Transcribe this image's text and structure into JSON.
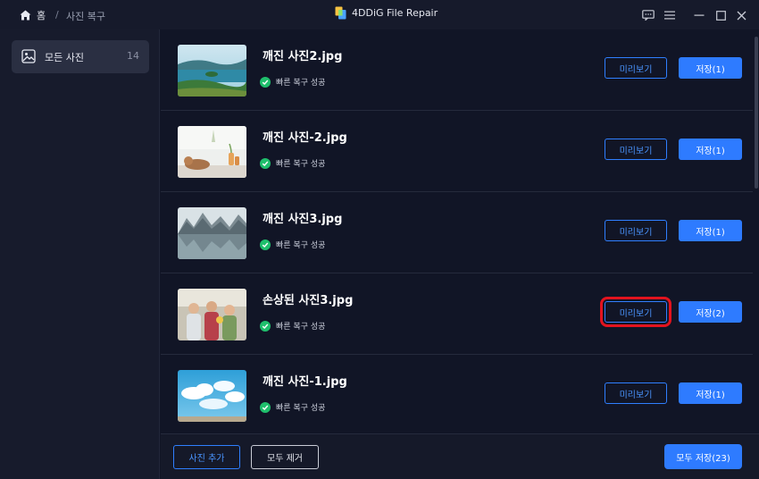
{
  "header": {
    "home_label": "홈",
    "separator": "/",
    "breadcrumb": "사진 복구",
    "app_title": "4DDiG File Repair"
  },
  "sidebar": {
    "items": [
      {
        "label": "모든 사진",
        "count": "14",
        "icon": "image-icon"
      }
    ]
  },
  "files": [
    {
      "name": "깨진 사진2.jpg",
      "status": "빠른 복구 성공",
      "preview_label": "미리보기",
      "save_label": "저장(1)",
      "thumb": "lake-island"
    },
    {
      "name": "깨진 사진-2.jpg",
      "status": "빠른 복구 성공",
      "preview_label": "미리보기",
      "save_label": "저장(1)",
      "thumb": "cat-window"
    },
    {
      "name": "깨진 사진3.jpg",
      "status": "빠른 복구 성공",
      "preview_label": "미리보기",
      "save_label": "저장(1)",
      "thumb": "mountain-lake"
    },
    {
      "name": "손상된 사진3.jpg",
      "status": "빠른 복구 성공",
      "preview_label": "미리보기",
      "save_label": "저장(2)",
      "thumb": "family"
    },
    {
      "name": "깨진 사진-1.jpg",
      "status": "빠른 복구 성공",
      "preview_label": "미리보기",
      "save_label": "저장(1)",
      "thumb": "sky-clouds"
    }
  ],
  "footer": {
    "add_label": "사진 추가",
    "remove_label": "모두 제거",
    "save_all_label": "모두 저장(23)"
  },
  "colors": {
    "accent": "#2e7bff",
    "success": "#1fbf6c",
    "highlight": "#e3131e",
    "background": "#111526"
  }
}
